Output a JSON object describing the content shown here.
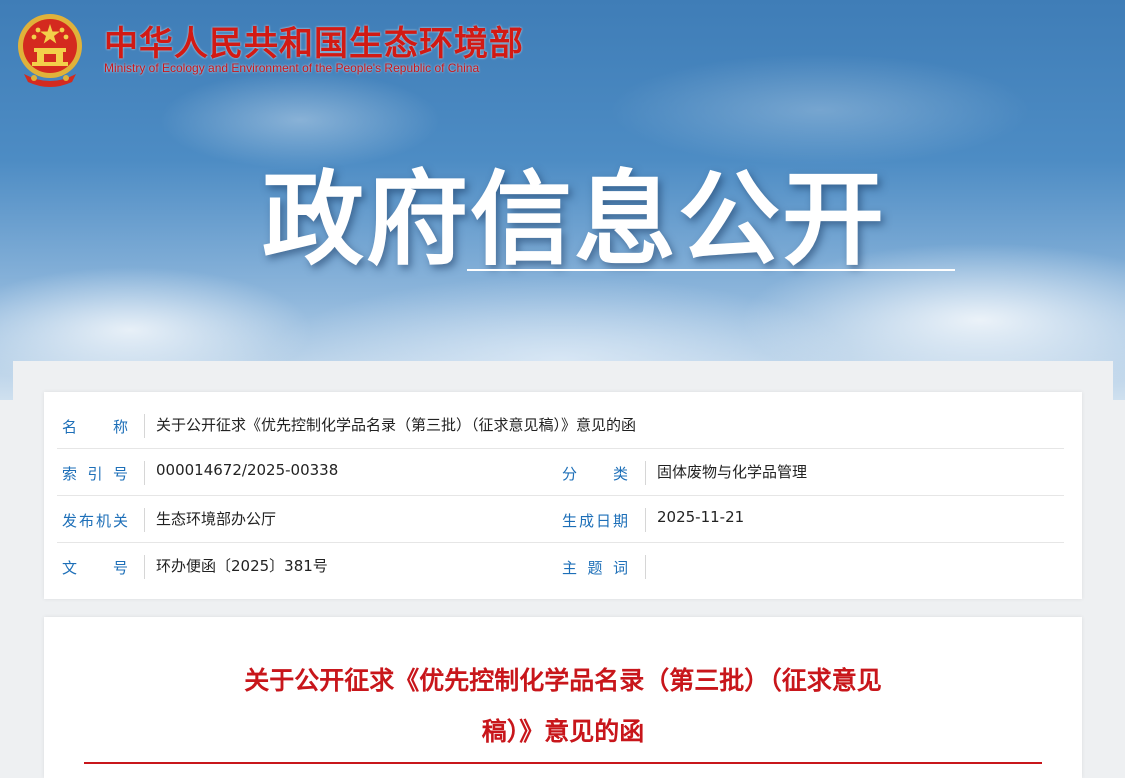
{
  "header": {
    "site_title": "中华人民共和国生态环境部",
    "site_subtitle": "Ministry of Ecology and Environment of the People's Republic of China",
    "emblem_icon": "national-emblem-icon",
    "hero_title": "政府信息公开"
  },
  "meta": {
    "name_label": "名称",
    "name_value": "关于公开征求《优先控制化学品名录（第三批）（征求意见稿）》意见的函",
    "index_label": "索引号",
    "index_value": "000014672/2025-00338",
    "category_label": "分类",
    "category_value": "固体废物与化学品管理",
    "issuer_label": "发布机关",
    "issuer_value": "生态环境部办公厅",
    "date_label": "生成日期",
    "date_value": "2025-11-21",
    "doc_no_label": "文号",
    "doc_no_value": "环办便函〔2025〕381号",
    "subject_label": "主题词",
    "subject_value": ""
  },
  "document": {
    "title_line1": "关于公开征求《优先控制化学品名录（第三批）（征求意见",
    "title_line2": "稿）》意见的函"
  },
  "colors": {
    "brand_red": "#c8161b",
    "label_blue": "#1d6fb8"
  }
}
